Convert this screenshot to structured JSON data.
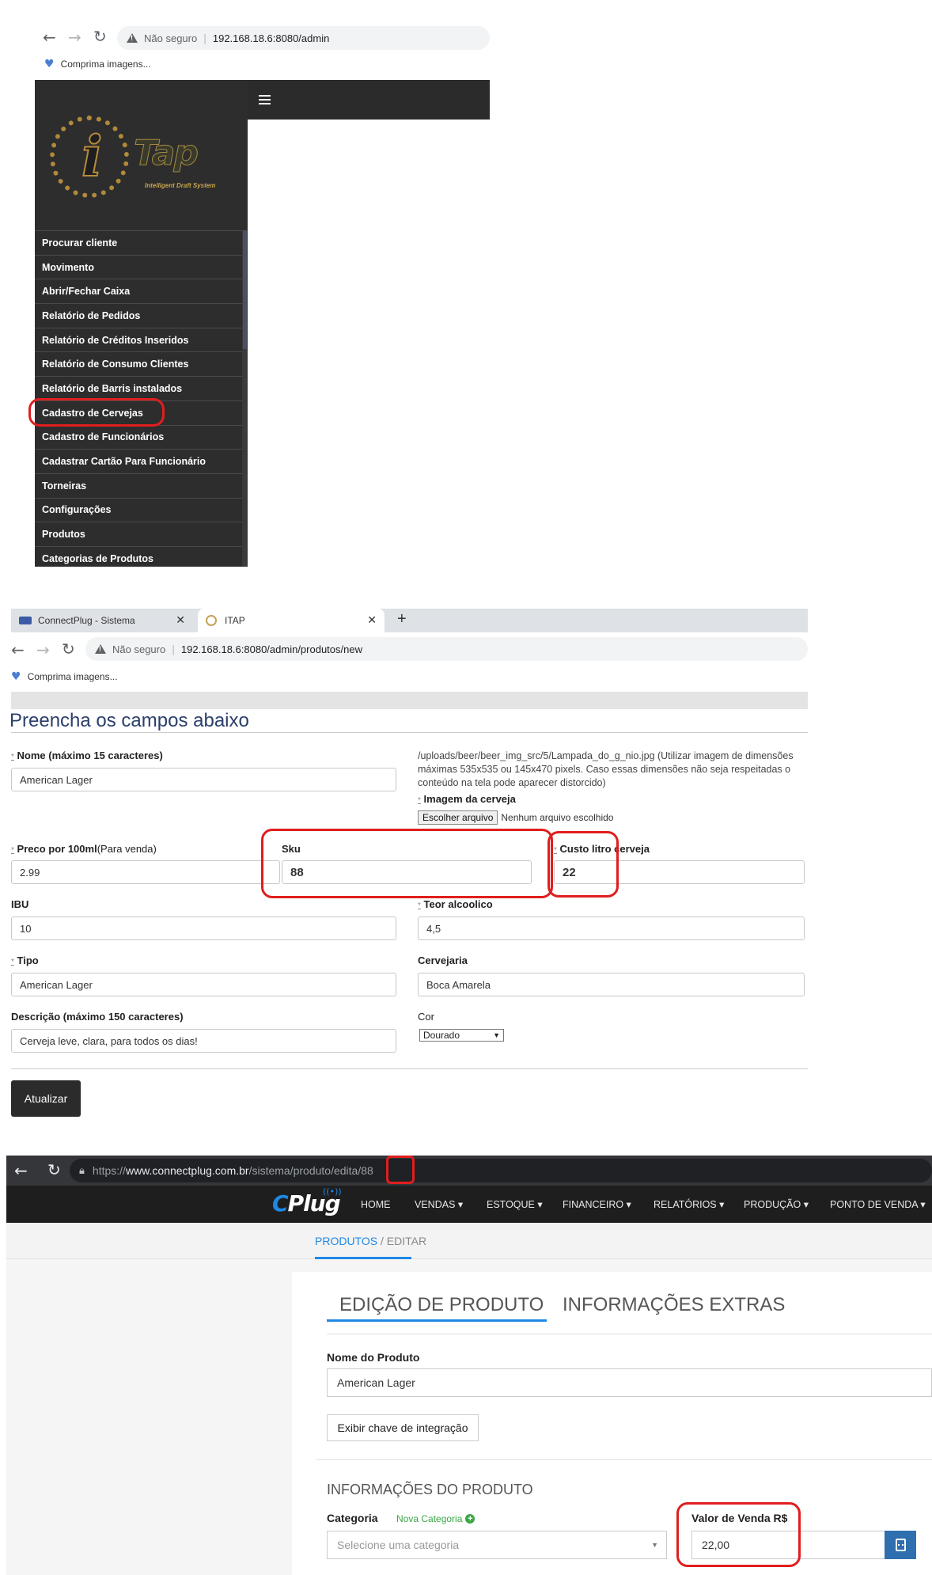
{
  "shot1": {
    "url_warning": "Não seguro",
    "url": "192.168.18.6:8080/admin",
    "bookmark": "Comprima imagens...",
    "logo": {
      "letter": "i",
      "brand": "Tap",
      "tagline": "Intelligent Draft System"
    },
    "menu": [
      "Procurar cliente",
      "Movimento",
      "Abrir/Fechar Caixa",
      "Relatório de Pedidos",
      "Relatório de Créditos Inseridos",
      "Relatório de Consumo Clientes",
      "Relatório de Barris instalados",
      "Cadastro de Cervejas",
      "Cadastro de Funcionários",
      "Cadastrar Cartão Para Funcionário",
      "Torneiras",
      "Configurações",
      "Produtos",
      "Categorias de Produtos"
    ],
    "highlighted_item": "Cadastro de Cervejas"
  },
  "shot2": {
    "tabs": [
      {
        "title": "ConnectPlug - Sistema"
      },
      {
        "title": "ITAP"
      }
    ],
    "new_tab": "+",
    "url_warning": "Não seguro",
    "url": "192.168.18.6:8080/admin/produtos/new",
    "bookmark": "Comprima imagens...",
    "form_title": "Preencha os campos abaixo",
    "fields": {
      "nome_label": "Nome (máximo 15 caracteres)",
      "nome_value": "American Lager",
      "image_help": "/uploads/beer/beer_img_src/5/Lampada_do_g_nio.jpg (Utilizar imagem de dimensões máximas 535x535 ou 145x470 pixels. Caso essas dimensões não seja respeitadas o conteúdo na tela pode aparecer distorcido)",
      "imagem_label": "Imagem da cerveja",
      "file_button": "Escolher arquivo",
      "file_status": "Nenhum arquivo escolhido",
      "preco_label": "Preco por 100ml",
      "preco_note": "(Para venda)",
      "preco_value": "2.99",
      "sku_label": "Sku",
      "sku_value": "88",
      "custo_label": "Custo litro cerveja",
      "custo_value": "22",
      "ibu_label": "IBU",
      "ibu_value": "10",
      "teor_label": "Teor alcoolico",
      "teor_value": "4,5",
      "tipo_label": "Tipo",
      "tipo_value": "American Lager",
      "cervejaria_label": "Cervejaria",
      "cervejaria_value": "Boca Amarela",
      "descricao_label": "Descrição (máximo 150 caracteres)",
      "descricao_value": "Cerveja leve, clara, para todos os dias!",
      "cor_label": "Cor",
      "cor_value": "Dourado"
    },
    "submit": "Atualizar",
    "required_mark": "*"
  },
  "shot3": {
    "url_scheme": "https://",
    "url_host": "www.connectplug.com.br",
    "url_path": "/sistema/produto/edita",
    "url_id": "/88",
    "brand": "Plug",
    "menu": [
      "HOME",
      "VENDAS ▾",
      "ESTOQUE ▾",
      "FINANCEIRO ▾",
      "RELATÓRIOS ▾",
      "PRODUÇÃO ▾",
      "PONTO DE VENDA ▾"
    ],
    "breadcrumb_active": "PRODUTOS",
    "breadcrumb_rest": " / EDITAR",
    "tab_edit": "EDIÇÃO DE PRODUTO",
    "tab_extra": "INFORMAÇÕES EXTRAS",
    "nome_label": "Nome do Produto",
    "nome_value": "American Lager",
    "integration_button": "Exibir chave de integração",
    "section_title": "INFORMAÇÕES DO PRODUTO",
    "categoria_label": "Categoria",
    "nova_categoria": "Nova Categoria",
    "categoria_placeholder": "Selecione uma categoria",
    "valor_label": "Valor de Venda R$",
    "valor_value": "22,00"
  },
  "colors": {
    "highlight_red": "#e01e1e",
    "sidebar_bg": "#2d2d2d",
    "cp_blue": "#1e88e5",
    "cp_green": "#3aa845",
    "form_title": "#2b3f6b"
  }
}
